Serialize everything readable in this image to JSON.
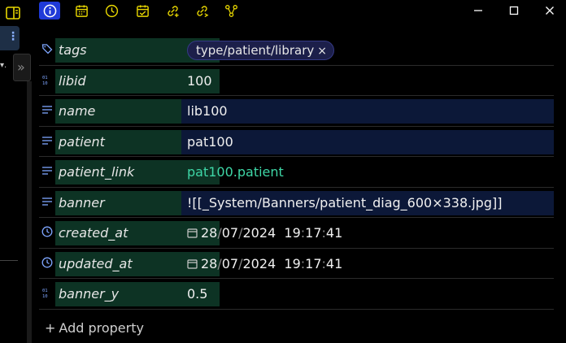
{
  "toolbar": {
    "icons": [
      "info-icon",
      "calendar-icon",
      "clock-icon",
      "calendar-check-icon",
      "link-add-icon",
      "link-forward-icon",
      "graph-icon"
    ],
    "window_controls": [
      "minimize-icon",
      "maximize-icon",
      "close-icon"
    ],
    "accent_color": "#1f3ad8",
    "icon_color": "#e8d700"
  },
  "properties": {
    "tags": {
      "key": "tags",
      "tag": "type/patient/library",
      "remove": "×"
    },
    "libid": {
      "key": "libid",
      "value": "100"
    },
    "name": {
      "key": "name",
      "value": "lib100"
    },
    "patient": {
      "key": "patient",
      "value": "pat100"
    },
    "patient_link": {
      "key": "patient_link",
      "value": "pat100.patient"
    },
    "banner": {
      "key": "banner",
      "value": "![[_System/Banners/patient_diag_600×338.jpg]]"
    },
    "created_at": {
      "key": "created_at",
      "day": "28",
      "month": "07",
      "year": "2024",
      "hour": "19",
      "minute": "17",
      "second": "41"
    },
    "updated_at": {
      "key": "updated_at",
      "day": "28",
      "month": "07",
      "year": "2024",
      "hour": "19",
      "minute": "17",
      "second": "41"
    },
    "banner_y": {
      "key": "banner_y",
      "value": "0.5"
    }
  },
  "add_property": {
    "plus": "+",
    "label": "Add property"
  },
  "colors": {
    "key_bg": "#0d3324",
    "value_bg": "#0c1838",
    "link": "#3ed6a6",
    "tag_bg": "#1c1f4a"
  }
}
